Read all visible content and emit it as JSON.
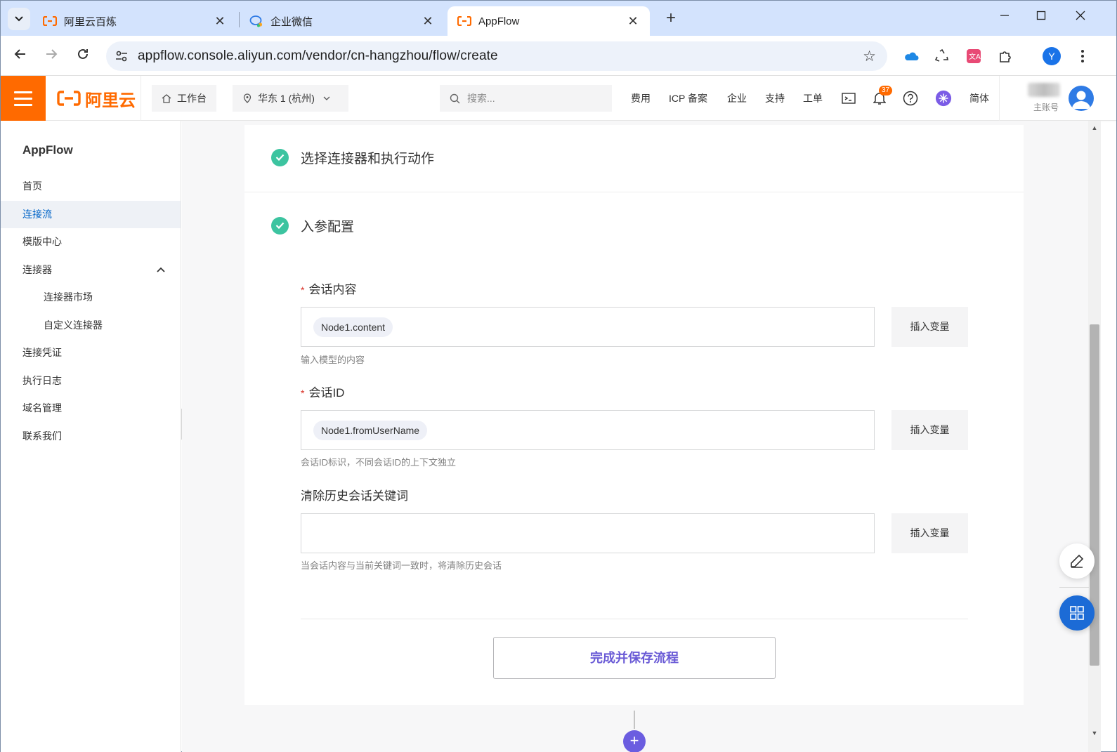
{
  "browser": {
    "tabs": [
      {
        "title": "阿里云百炼",
        "icon": "aliyun-icon"
      },
      {
        "title": "企业微信",
        "icon": "wecom-icon"
      },
      {
        "title": "AppFlow",
        "icon": "aliyun-icon"
      }
    ],
    "active_tab": 2,
    "url": "appflow.console.aliyun.com/vendor/cn-hangzhou/flow/create",
    "profile_initial": "Y"
  },
  "console_header": {
    "logo_text": "阿里云",
    "workbench_label": "工作台",
    "region_label": "华东 1 (杭州)",
    "search_placeholder": "搜索...",
    "links": [
      "费用",
      "ICP 备案",
      "企业",
      "支持",
      "工单"
    ],
    "notification_count": "37",
    "language_label": "简体",
    "account_label": "主账号"
  },
  "sidebar": {
    "title": "AppFlow",
    "items": [
      {
        "label": "首页",
        "active": false
      },
      {
        "label": "连接流",
        "active": true
      },
      {
        "label": "模版中心",
        "active": false
      },
      {
        "label": "连接器",
        "active": false,
        "expanded": true
      },
      {
        "label": "连接器市场",
        "sub": true
      },
      {
        "label": "自定义连接器",
        "sub": true
      },
      {
        "label": "连接凭证",
        "active": false
      },
      {
        "label": "执行日志",
        "active": false
      },
      {
        "label": "域名管理",
        "active": false
      },
      {
        "label": "联系我们",
        "active": false
      }
    ]
  },
  "main": {
    "steps": [
      {
        "label": "选择连接器和执行动作",
        "status": "done"
      },
      {
        "label": "入参配置",
        "status": "done"
      }
    ],
    "fields": [
      {
        "label": "会话内容",
        "required": true,
        "value_chip": "Node1.content",
        "insert_label": "插入变量",
        "help": "输入模型的内容"
      },
      {
        "label": "会话ID",
        "required": true,
        "value_chip": "Node1.fromUserName",
        "insert_label": "插入变量",
        "help": "会话ID标识，不同会话ID的上下文独立"
      },
      {
        "label": "清除历史会话关键词",
        "required": false,
        "value_chip": "",
        "insert_label": "插入变量",
        "help": "当会话内容与当前关键词一致时，将清除历史会话"
      }
    ],
    "save_button": "完成并保存流程",
    "add_node_symbol": "+"
  },
  "colors": {
    "brand_orange": "#ff6a00",
    "active_blue": "#0064c8",
    "success_green": "#3cc4a0",
    "primary_purple": "#6a5bd6"
  }
}
